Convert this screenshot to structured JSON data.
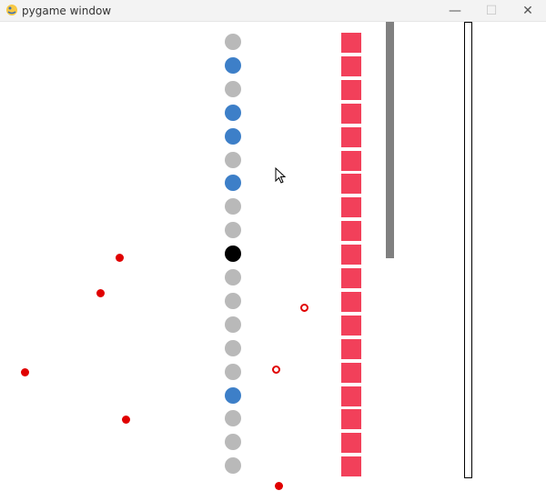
{
  "window": {
    "title": "pygame window",
    "app_icon": "pygame-snake-icon",
    "controls": {
      "minimize": "—",
      "maximize": "☐",
      "close": "✕"
    }
  },
  "colors": {
    "gray_dot": "#b9b9b9",
    "blue_dot": "#3d7fc8",
    "black_dot": "#000000",
    "red_block": "#f2405a",
    "gray_bar": "#808080",
    "outline_bar_border": "#000000",
    "red_particle": "#e00000"
  },
  "game": {
    "dot_column": [
      "gray",
      "blue",
      "gray",
      "blue",
      "blue",
      "gray",
      "blue",
      "gray",
      "gray",
      "black",
      "gray",
      "gray",
      "gray",
      "gray",
      "gray",
      "blue",
      "gray",
      "gray",
      "gray"
    ],
    "block_count": 19,
    "gray_bar_fill_fraction": 0.52,
    "outline_bar_fill_fraction": 0
  }
}
